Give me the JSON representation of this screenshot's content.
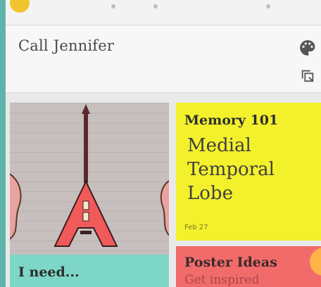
{
  "header": {
    "title": "Call Jennifer"
  },
  "notes": [
    {
      "kind": "image-note",
      "image": "guitar-illustration"
    },
    {
      "kind": "text-note",
      "color": "#7dd6c6",
      "title": "I need..."
    },
    {
      "kind": "text-note",
      "color": "#f3f12b",
      "title": "Memory 101",
      "body": [
        "Medial",
        "Temporal",
        "Lobe"
      ],
      "date": "Feb 27"
    },
    {
      "kind": "text-note",
      "color": "#f26b6b",
      "title": "Poster Ideas",
      "body": "Get inspired"
    }
  ],
  "icons": {
    "palette": "palette-icon",
    "crop": "crop-icon",
    "fab": "fab-button"
  },
  "colors": {
    "background": "#5fb3ab",
    "header": "#f7f7f7",
    "teal": "#7dd6c6",
    "yellow": "#f3f12b",
    "red": "#f26b6b",
    "accent": "#ffb347"
  }
}
